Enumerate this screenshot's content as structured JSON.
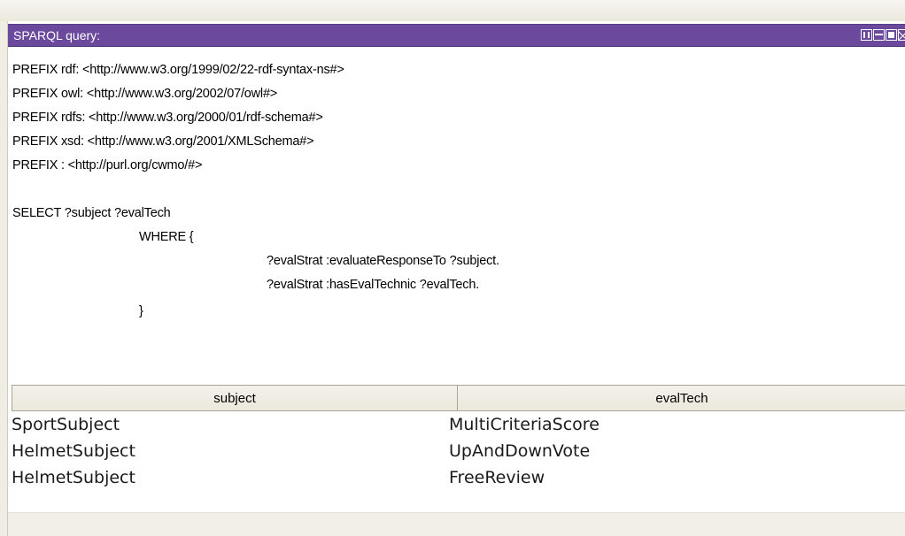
{
  "panel": {
    "title": "SPARQL query:"
  },
  "query": {
    "lines": [
      "PREFIX rdf: <http://www.w3.org/1999/02/22-rdf-syntax-ns#>",
      "PREFIX owl: <http://www.w3.org/2002/07/owl#>",
      "PREFIX rdfs: <http://www.w3.org/2000/01/rdf-schema#>",
      "PREFIX xsd: <http://www.w3.org/2001/XMLSchema#>",
      "PREFIX : <http://purl.org/cwmo/#>",
      "",
      "SELECT ?subject ?evalTech",
      "WHERE {",
      "?evalStrat :evaluateResponseTo ?subject.",
      "?evalStrat :hasEvalTechnic ?evalTech.",
      "}"
    ]
  },
  "results": {
    "columns": [
      "subject",
      "evalTech"
    ],
    "rows": [
      [
        "SportSubject",
        "MultiCriteriaScore"
      ],
      [
        "HelmetSubject",
        "UpAndDownVote"
      ],
      [
        "HelmetSubject",
        "FreeReview"
      ]
    ]
  },
  "window_controls": {
    "icons": [
      "cascade-icon",
      "tile-icon",
      "maximize-icon",
      "close-icon"
    ]
  },
  "colors": {
    "title_bar": "#6b4a9d",
    "title_text": "#ffffff",
    "header_bg": "#efede4"
  }
}
